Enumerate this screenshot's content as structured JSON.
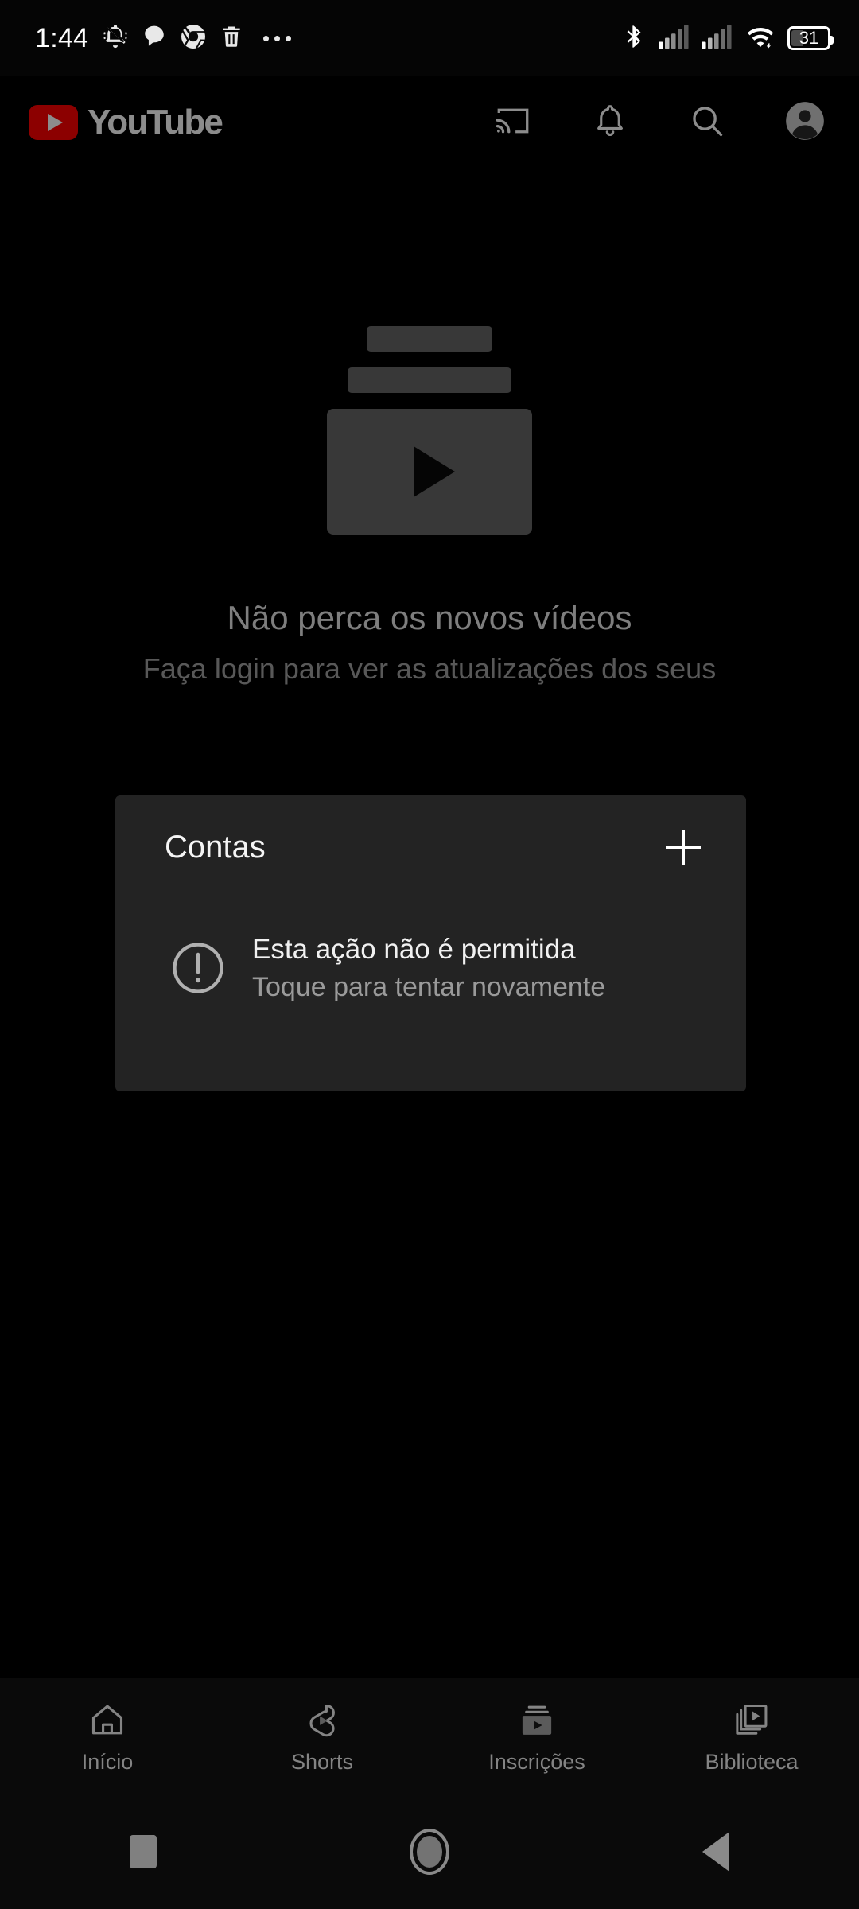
{
  "status_bar": {
    "time": "1:44",
    "battery_percent": "31",
    "left_icons": [
      "silent-bell-icon",
      "chat-bubble-icon",
      "chrome-icon",
      "trash-icon",
      "more-notifications-icon"
    ],
    "right_icons": [
      "bluetooth-icon",
      "signal-sim1-icon",
      "signal-sim2-icon",
      "wifi-icon",
      "battery-icon"
    ]
  },
  "header": {
    "brand": "YouTube",
    "actions": [
      {
        "name": "cast-icon",
        "label": "Transmitir"
      },
      {
        "name": "notifications-bell-icon",
        "label": "Notificações"
      },
      {
        "name": "search-icon",
        "label": "Pesquisar"
      },
      {
        "name": "account-avatar-icon",
        "label": "Conta"
      }
    ]
  },
  "empty_state": {
    "illustration": "stacked-videos-icon",
    "title": "Não perca os novos vídeos",
    "subtitle": "Faça login para ver as atualizações dos seus"
  },
  "accounts_dialog": {
    "title": "Contas",
    "add_button_icon": "plus-icon",
    "error": {
      "icon": "alert-circle-icon",
      "primary": "Esta ação não é permitida",
      "secondary": "Toque para tentar novamente"
    }
  },
  "bottom_nav": {
    "items": [
      {
        "label": "Início",
        "icon": "home-icon",
        "active": false
      },
      {
        "label": "Shorts",
        "icon": "shorts-icon",
        "active": false
      },
      {
        "label": "Inscrições",
        "icon": "subscriptions-icon",
        "active": true
      },
      {
        "label": "Biblioteca",
        "icon": "library-icon",
        "active": false
      }
    ]
  },
  "system_nav": {
    "buttons": [
      {
        "name": "recents-button",
        "icon": "square-icon"
      },
      {
        "name": "home-button",
        "icon": "circle-icon"
      },
      {
        "name": "back-button",
        "icon": "triangle-left-icon"
      }
    ]
  },
  "colors": {
    "background": "#000000",
    "card": "#232323",
    "brand_red": "#ff0000",
    "primary_text": "#f1f1f1",
    "secondary_text": "#9a9a9a"
  }
}
